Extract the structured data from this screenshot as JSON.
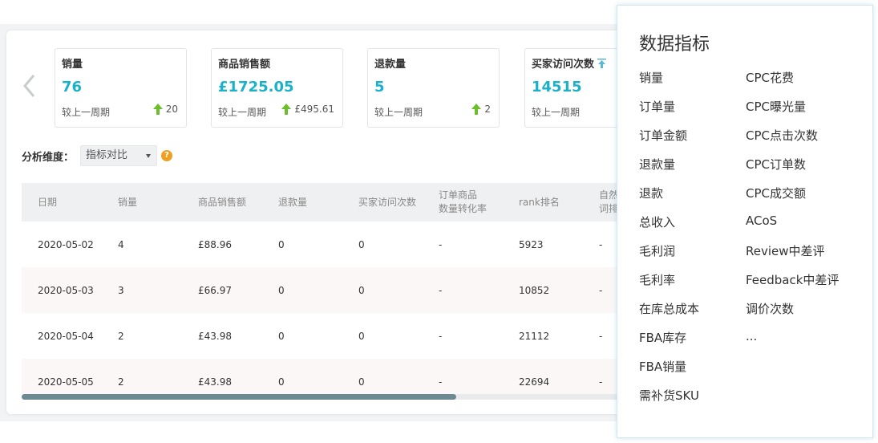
{
  "metrics": [
    {
      "label": "销量",
      "value": "76",
      "compare": "较上一周期",
      "delta": "20"
    },
    {
      "label": "商品销售额",
      "value": "£1725.05",
      "compare": "较上一周期",
      "delta": "£495.61"
    },
    {
      "label": "退款量",
      "value": "5",
      "compare": "较上一周期",
      "delta": "2"
    },
    {
      "label": "买家访问次数",
      "value": "14515",
      "compare": "较上一周期",
      "delta": ""
    }
  ],
  "dimension": {
    "label": "分析维度：",
    "selected": "指标对比",
    "help": "?"
  },
  "table": {
    "headers": [
      "日期",
      "销量",
      "商品销售额",
      "退款量",
      "买家访问次数",
      "订单商品",
      "数量转化率",
      "rank排名",
      "自然",
      "词排"
    ],
    "rows": [
      [
        "2020-05-02",
        "4",
        "£88.96",
        "0",
        "0",
        "-",
        "5923",
        "-"
      ],
      [
        "2020-05-03",
        "3",
        "£66.97",
        "0",
        "0",
        "-",
        "10852",
        "-"
      ],
      [
        "2020-05-04",
        "2",
        "£43.98",
        "0",
        "0",
        "-",
        "21112",
        "-"
      ],
      [
        "2020-05-05",
        "2",
        "£43.98",
        "0",
        "0",
        "-",
        "22694",
        "-"
      ]
    ]
  },
  "popover": {
    "title": "数据指标",
    "col1": [
      "销量",
      "订单量",
      "订单金额",
      "退款量",
      "退款",
      "总收入",
      "毛利润",
      "毛利率",
      "在库总成本",
      "FBA库存",
      "FBA销量",
      "需补货SKU"
    ],
    "col2": [
      "CPC花费",
      "CPC曝光量",
      "CPC点击次数",
      "CPC订单数",
      "CPC成交额",
      "ACoS",
      "Review中差评",
      "Feedback中差评",
      "调价次数",
      "..."
    ]
  },
  "colors": {
    "accent": "#1ab1c9",
    "up_arrow": "#6abf2a",
    "help": "#f0a020"
  },
  "icons": {
    "prev": "chevron-left-icon",
    "delta": "arrow-up-icon",
    "visits": "upload-icon",
    "help": "question-icon"
  }
}
